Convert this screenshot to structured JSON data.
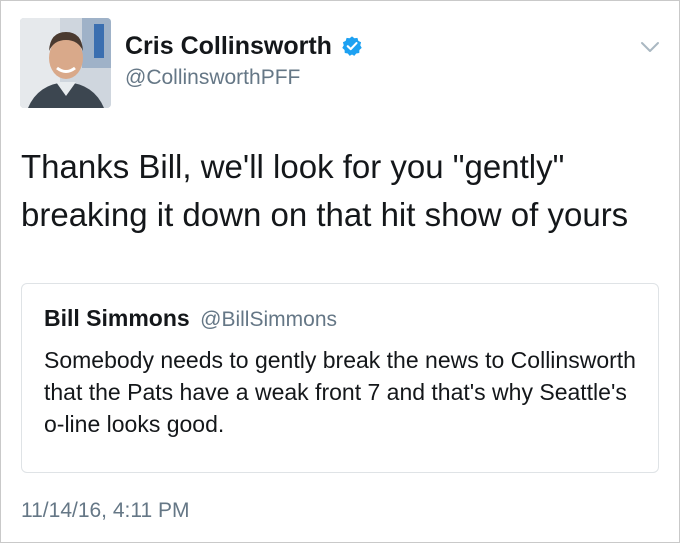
{
  "author": {
    "display_name": "Cris Collinsworth",
    "handle": "@CollinsworthPFF",
    "verified": true
  },
  "tweet": {
    "text": "Thanks Bill, we'll look for you \"gently\" breaking it down on that hit show of yours",
    "timestamp": "11/14/16, 4:11 PM"
  },
  "quoted_tweet": {
    "display_name": "Bill Simmons",
    "handle": "@BillSimmons",
    "text": "Somebody needs to gently break the news to Collinsworth that the Pats have a weak front 7 and that's why Seattle's o-line looks good."
  },
  "icons": {
    "verified": "verified-badge-icon",
    "menu": "chevron-down-icon"
  },
  "colors": {
    "verified_blue": "#1da1f2",
    "secondary_text": "#657786",
    "primary_text": "#14171a"
  }
}
